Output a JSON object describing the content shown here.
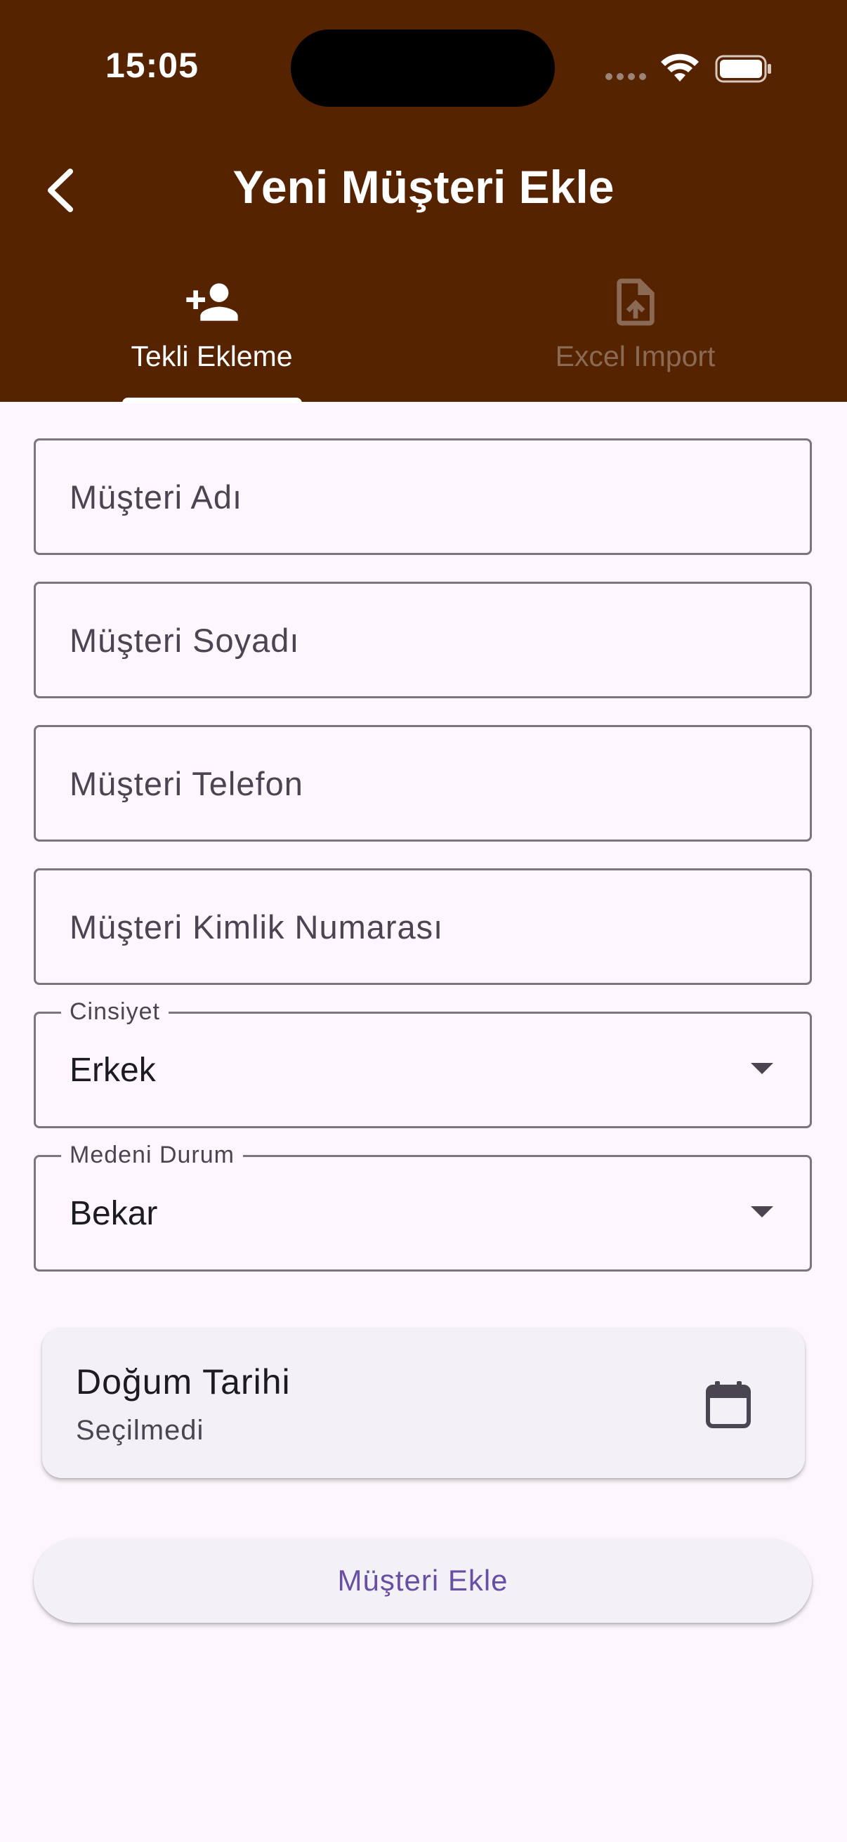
{
  "status_bar": {
    "time": "15:05"
  },
  "header": {
    "title": "Yeni Müşteri Ekle"
  },
  "tabs": [
    {
      "label": "Tekli Ekleme",
      "icon": "person-add-icon",
      "selected": true
    },
    {
      "label": "Excel Import",
      "icon": "file-upload-icon",
      "selected": false
    }
  ],
  "form": {
    "first_name": {
      "placeholder": "Müşteri Adı",
      "value": ""
    },
    "last_name": {
      "placeholder": "Müşteri Soyadı",
      "value": ""
    },
    "phone": {
      "placeholder": "Müşteri Telefon",
      "value": ""
    },
    "national_id": {
      "placeholder": "Müşteri Kimlik Numarası",
      "value": ""
    },
    "gender": {
      "label": "Cinsiyet",
      "value": "Erkek"
    },
    "marital_status": {
      "label": "Medeni Durum",
      "value": "Bekar"
    },
    "birth_date": {
      "label": "Doğum Tarihi",
      "value": "Seçilmedi"
    }
  },
  "submit": {
    "label": "Müşteri Ekle"
  },
  "colors": {
    "header_bg": "#562300",
    "page_bg": "#fdf7fd",
    "accent": "#6750a4"
  }
}
